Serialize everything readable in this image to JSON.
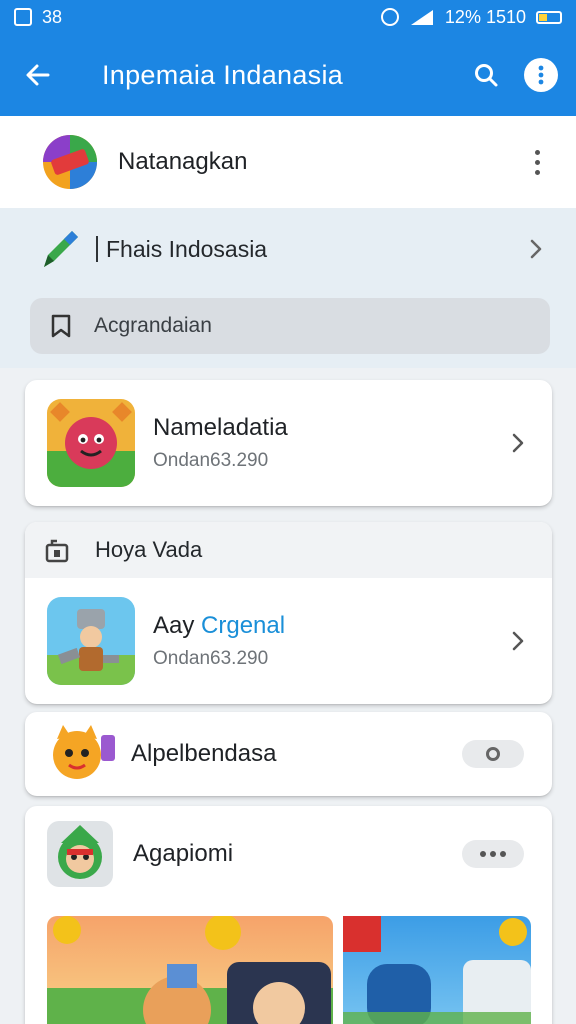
{
  "status_bar": {
    "left_text": "38",
    "right_text": "12% 1510"
  },
  "app_bar": {
    "title": "Inpemaia Indanasia"
  },
  "top_row": {
    "label": "Natanagkan"
  },
  "pen_row": {
    "label": "Fhais Indosasia"
  },
  "search_field": {
    "label": "Acgrandaian"
  },
  "card1": {
    "name": "Nameladatia",
    "sub": "Ondan63.290"
  },
  "card2": {
    "header_label": "Hoya Vada",
    "name_prefix": "Aay",
    "name_accent": "Crgenal",
    "sub": "Ondan63.290"
  },
  "card3": {
    "label": "Alpelbendasa"
  },
  "card4": {
    "label": "Agapiomi"
  },
  "colors": {
    "app_bar": "#1c86e3",
    "accent": "#1a8fd8",
    "background": "#eef1f4"
  }
}
